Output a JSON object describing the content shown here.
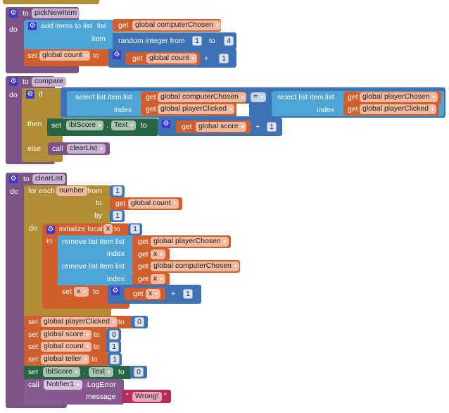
{
  "colors": {
    "procedure": "#7c5385",
    "control": "#b18e35",
    "lists": "#4ea5d5",
    "math": "#3f71b5",
    "variables": "#d05f2d",
    "component": "#266643",
    "text": "#b32d5e"
  },
  "kw": {
    "to": "to",
    "do": "do",
    "get": "get",
    "set": "set",
    "call": "call",
    "if": "if",
    "then": "then",
    "else": "else",
    "in": "in",
    "plus": "+",
    "eq": "=",
    "dot": ".",
    "dd": "▾",
    "quote": "\"",
    "gear": "⚙"
  },
  "pickNewItem": {
    "name": "pickNewItem",
    "add_items": "add items to list",
    "list": "list",
    "item": "item",
    "list_var": "global computerChosen",
    "random": "random integer from",
    "from": "1",
    "to_val": "4",
    "set_var": "global count",
    "get_var": "global count",
    "add_val": "1"
  },
  "compare": {
    "name": "compare",
    "select1": "select list item",
    "list": "list",
    "index": "index",
    "left_list": "global computerChosen",
    "left_index": "global playerClicked",
    "right_list": "global playerChosen",
    "right_index": "global playerClicked",
    "component": "lblScore",
    "property": "Text",
    "score_var": "global score",
    "add_val": "1",
    "else_call": "clearList"
  },
  "clearList": {
    "name": "clearList",
    "for_each": "for each",
    "loop_var": "number",
    "from": "from",
    "from_val": "1",
    "to_var": "global count",
    "by": "by",
    "by_val": "1",
    "init_local": "initialize local",
    "local_var": "x",
    "init_val": "1",
    "remove": "remove list item",
    "list1": "global playerChosen",
    "list2": "global computerChosen",
    "index": "index",
    "list": "list",
    "add_val": "1",
    "sets": [
      {
        "var": "global playerClicked",
        "val": "0"
      },
      {
        "var": "global score",
        "val": "0"
      },
      {
        "var": "global count",
        "val": "1"
      },
      {
        "var": "global teller",
        "val": "1"
      }
    ],
    "component": "lblScore",
    "property": "Text",
    "comp_val": "0",
    "notifier": "Notifier1",
    "method": ".LogError",
    "message_label": "message",
    "message": "Wrong!"
  }
}
